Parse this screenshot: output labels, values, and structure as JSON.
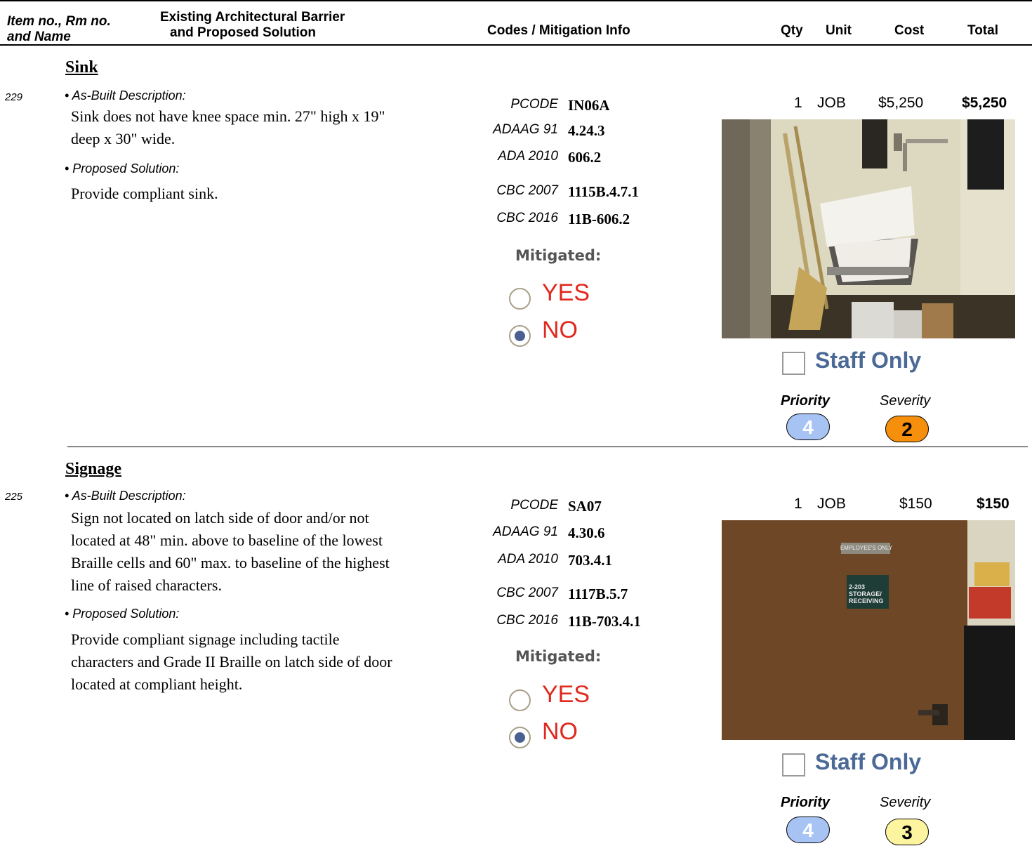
{
  "header": {
    "col1_line1": "Item no., Rm no.",
    "col1_line2": "and Name",
    "col2_line1": "Existing Architectural Barrier",
    "col2_line2": "and Proposed Solution",
    "col3": "Codes / Mitigation Info",
    "qty": "Qty",
    "unit": "Unit",
    "cost": "Cost",
    "total": "Total"
  },
  "items": [
    {
      "title": "Sink",
      "item_no": "229",
      "as_built_label": "• As-Built Description:",
      "as_built_lines": [
        "Sink does not have knee space min. 27\" high x 19\"",
        "deep x 30\" wide."
      ],
      "solution_label": "• Proposed Solution:",
      "solution_lines": [
        "Provide compliant sink."
      ],
      "codes": [
        {
          "key": "PCODE",
          "value": "IN06A"
        },
        {
          "key": "ADAAG 91",
          "value": "4.24.3"
        },
        {
          "key": "ADA 2010",
          "value": "606.2"
        },
        {
          "key": "CBC 2007",
          "value": "1115B.4.7.1"
        },
        {
          "key": "CBC 2016",
          "value": "11B-606.2"
        }
      ],
      "mitigated_label": "Mitigated:",
      "yes_label": "YES",
      "no_label": "NO",
      "mitigated": "NO",
      "qty": "1",
      "unit": "JOB",
      "cost": "$5,250",
      "total": "$5,250",
      "staff_only_label": "Staff Only",
      "staff_only": false,
      "priority_label": "Priority",
      "severity_label": "Severity",
      "priority": "4",
      "severity": "2",
      "priority_color": "#a7c3f4",
      "severity_color": "#f58f0c"
    },
    {
      "title": "Signage",
      "item_no": "225",
      "as_built_label": "• As-Built Description:",
      "as_built_lines": [
        "Sign not located on latch side of door and/or not",
        "located at 48\" min. above to baseline of the lowest",
        "Braille cells and 60\" max. to baseline of the highest",
        "line of raised characters."
      ],
      "solution_label": "• Proposed Solution:",
      "solution_lines": [
        "Provide compliant signage including tactile",
        "characters and Grade II Braille on latch side of door",
        "located at compliant height."
      ],
      "codes": [
        {
          "key": "PCODE",
          "value": "SA07"
        },
        {
          "key": "ADAAG 91",
          "value": "4.30.6"
        },
        {
          "key": "ADA 2010",
          "value": "703.4.1"
        },
        {
          "key": "CBC 2007",
          "value": "1117B.5.7"
        },
        {
          "key": "CBC 2016",
          "value": "11B-703.4.1"
        }
      ],
      "mitigated_label": "Mitigated:",
      "yes_label": "YES",
      "no_label": "NO",
      "mitigated": "NO",
      "qty": "1",
      "unit": "JOB",
      "cost": "$150",
      "total": "$150",
      "staff_only_label": "Staff Only",
      "staff_only": false,
      "priority_label": "Priority",
      "severity_label": "Severity",
      "priority": "4",
      "severity": "3",
      "priority_color": "#a7c3f4",
      "severity_color": "#fdf4a0",
      "photo_sign_lines": [
        "2-203",
        "STORAGE/",
        "RECEIVING"
      ],
      "photo_name_plate": "EMPLOYEE'S ONLY"
    }
  ]
}
